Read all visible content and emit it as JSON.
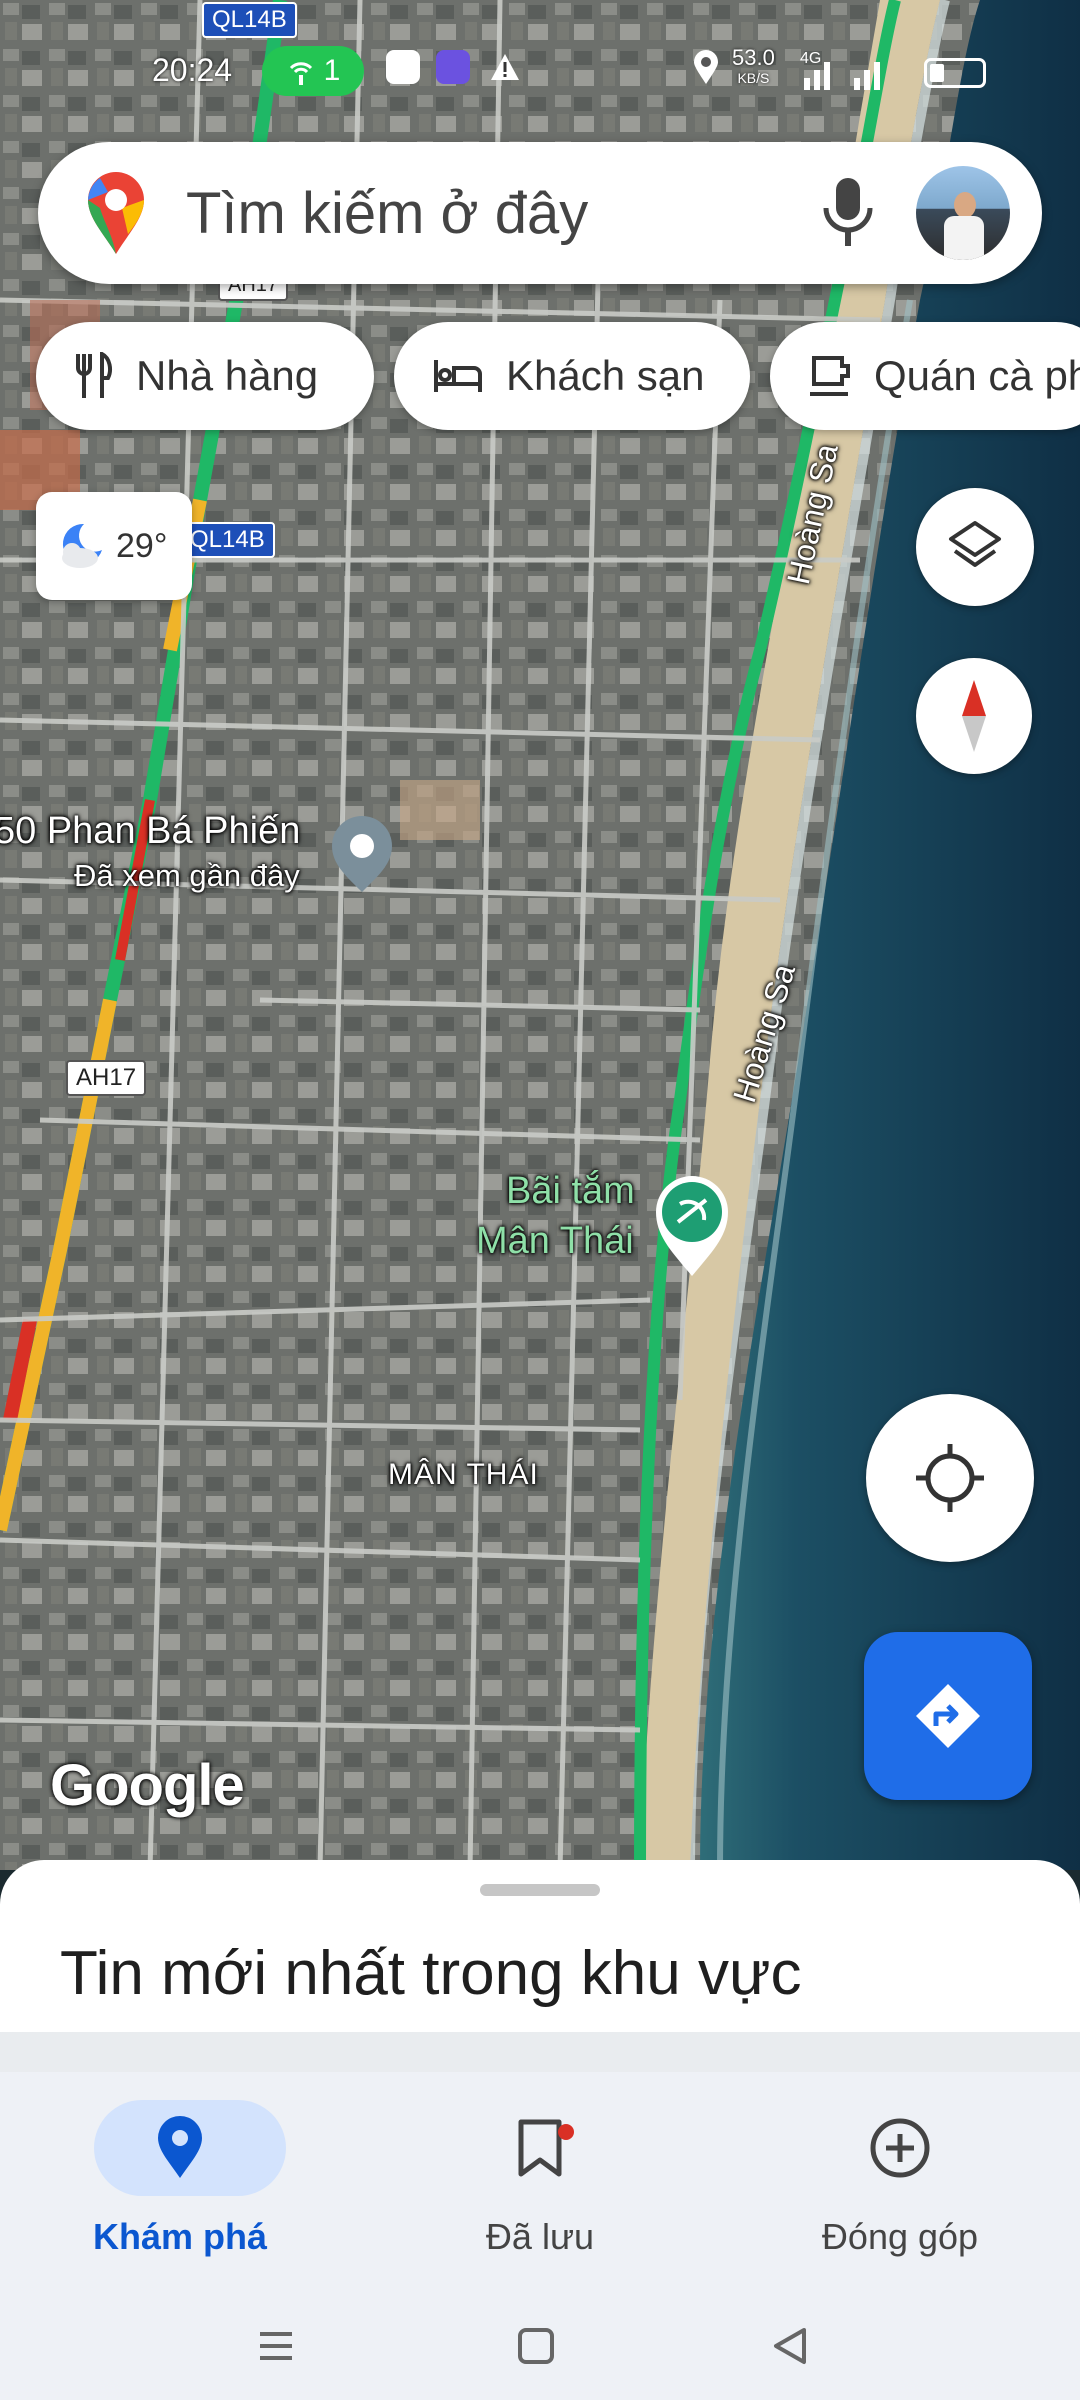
{
  "status_bar": {
    "time": "20:24",
    "hotspot_count": "1",
    "net_speed_value": "53.0",
    "net_speed_unit": "KB/S",
    "network_type": "4G"
  },
  "search": {
    "placeholder": "Tìm kiếm ở đây"
  },
  "chips": [
    {
      "label": "Nhà hàng",
      "icon": "restaurant-icon"
    },
    {
      "label": "Khách sạn",
      "icon": "hotel-icon"
    },
    {
      "label": "Quán cà phê",
      "icon": "cafe-icon"
    }
  ],
  "weather": {
    "temperature": "29°",
    "icon": "partly-cloudy-night-icon"
  },
  "map": {
    "road_shields": [
      "QL14B",
      "AH17",
      "QL14B",
      "AH17"
    ],
    "recent_place_name": "50 Phan Bá Phiến",
    "recent_place_sub": "Đã xem gần đây",
    "street_labels": [
      "Hoàng Sa",
      "Hoàng Sa"
    ],
    "poi_name_line1": "Bãi tắm",
    "poi_name_line2": "Mân Thái",
    "district_label": "MÂN THÁI",
    "attribution": "Google",
    "colors": {
      "traffic_green": "#1fb866",
      "traffic_yellow": "#f0b429",
      "traffic_red": "#d93025",
      "sea": "#123a4f",
      "poi_green": "#34a853"
    }
  },
  "bottom_sheet": {
    "title": "Tin mới nhất trong khu vực"
  },
  "bottom_nav": {
    "items": [
      {
        "label": "Khám phá",
        "icon": "explore-pin-icon",
        "active": true
      },
      {
        "label": "Đã lưu",
        "icon": "bookmark-icon",
        "active": false
      },
      {
        "label": "Đóng góp",
        "icon": "add-circle-icon",
        "active": false
      }
    ]
  }
}
